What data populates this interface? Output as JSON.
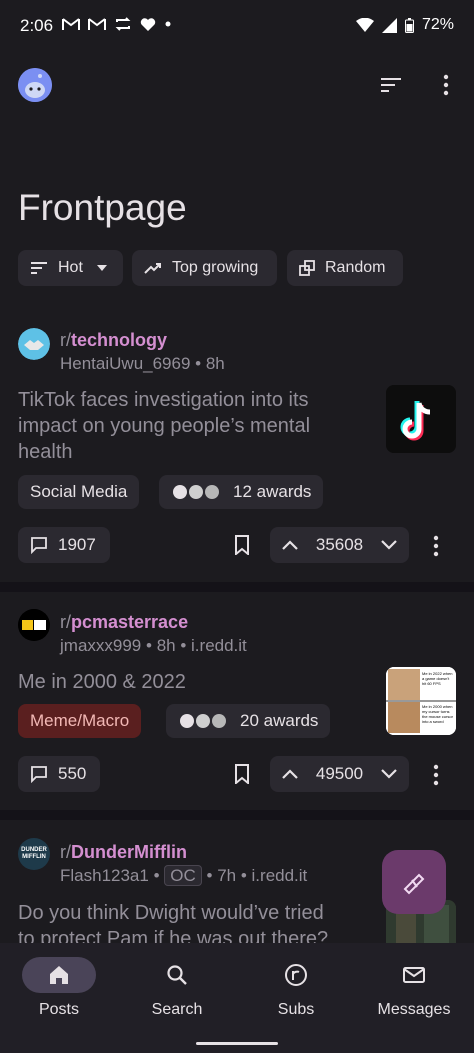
{
  "status_bar": {
    "time": "2:06",
    "battery": "72%",
    "icons": [
      "gmail-icon",
      "gmail-icon",
      "sync-icon",
      "heart-icon",
      "dot-icon",
      "wifi-icon",
      "signal-icon",
      "battery-icon"
    ]
  },
  "header": {
    "title": "Frontpage",
    "filters": [
      {
        "label": "Hot",
        "icon": "sort-icon",
        "dropdown": true
      },
      {
        "label": "Top growing",
        "icon": "trending-up-icon"
      },
      {
        "label": "Random",
        "icon": "random-icon"
      }
    ]
  },
  "posts": [
    {
      "subreddit_prefix": "r/",
      "subreddit": "technology",
      "author": "HentaiUwu_6969",
      "time": "8h",
      "domain": "",
      "title_lines": [
        "TikTok faces investigation into its",
        "impact on young people’s mental",
        "health"
      ],
      "flair": "Social Media",
      "awards": "12 awards",
      "comments": "1907",
      "score": "35608"
    },
    {
      "subreddit_prefix": "r/",
      "subreddit": "pcmasterrace",
      "author": "jmaxxx999",
      "time": "8h",
      "domain": "i.redd.it",
      "title_lines": [
        "Me in 2000 & 2022"
      ],
      "flair": "Meme/Macro",
      "awards": "20 awards",
      "comments": "550",
      "score": "49500",
      "thumb_text_top": "Me in 2022 when a game doesn't hit 60 FPS",
      "thumb_text_bottom": "Me in 2000 when my cursor turns the mouse cursor into a sword"
    },
    {
      "subreddit_prefix": "r/",
      "subreddit": "DunderMifflin",
      "author": "Flash123a1",
      "badge": "OC",
      "time": "7h",
      "domain": "i.redd.it",
      "title_lines": [
        "Do you think Dwight would’ve tried",
        "to protect Pam if he was out there?"
      ],
      "icon_text_top": "DUNDER",
      "icon_text_bottom": "MIFFLIN"
    }
  ],
  "bottom_nav": {
    "items": [
      {
        "label": "Posts",
        "icon": "home-icon",
        "active": true
      },
      {
        "label": "Search",
        "icon": "search-icon"
      },
      {
        "label": "Subs",
        "icon": "subreddit-icon"
      },
      {
        "label": "Messages",
        "icon": "mail-icon"
      }
    ]
  },
  "colors": {
    "background": "#141218",
    "surface": "#1c1b1f",
    "subreddit_accent": "#d48fd0",
    "fab": "#6b3a6b"
  }
}
